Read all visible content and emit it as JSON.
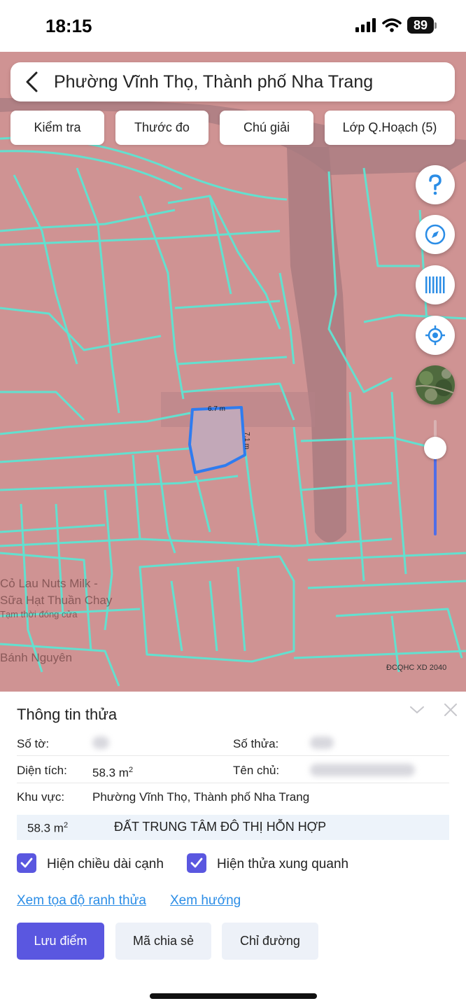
{
  "status_bar": {
    "time": "18:15",
    "battery": "89"
  },
  "search": {
    "title": "Phường Vĩnh Thọ, Thành phố Nha Trang"
  },
  "chips": [
    "Kiểm tra",
    "Thước đo",
    "Chú giải",
    "Lớp Q.Hoạch (5)"
  ],
  "map": {
    "measure_top": "6.7 m",
    "measure_right": "7.1 m",
    "labels": [
      "Cỏ Lau Nuts Milk -",
      "Sữa Hạt Thuần Chay",
      "Tạm thời đóng cửa",
      "Bánh Nguyên"
    ],
    "credit": "ĐCQHC XD 2040",
    "zoom_level": 0.82,
    "colors": {
      "zone": "#cf9393",
      "parcel_lines": "#63e0cf",
      "selected": "#2e7cf0",
      "road": "#a77b80"
    }
  },
  "side_buttons": [
    "help-icon",
    "compass-icon",
    "barcode-icon",
    "locate-icon",
    "satellite-layer"
  ],
  "panel": {
    "title": "Thông tin thửa",
    "so_to_label": "Số tờ:",
    "so_thua_label": "Số thửa:",
    "dien_tich_label": "Diện tích:",
    "dien_tich_value": "58.3 m",
    "dien_tich_unit_sup": "2",
    "ten_chu_label": "Tên chủ:",
    "khu_vuc_label": "Khu vực:",
    "khu_vuc_value": "Phường Vĩnh Thọ, Thành phố Nha Trang",
    "landuse": {
      "area": "58.3 m",
      "area_sup": "2",
      "name": "ĐẤT TRUNG TÂM ĐÔ THỊ HỖN HỢP"
    },
    "checkbox_edges": "Hiện chiều dài cạnh",
    "checkbox_neighbors": "Hiện thửa xung quanh",
    "link_coords": "Xem tọa độ ranh thửa",
    "link_direction": "Xem hướng",
    "btn_save": "Lưu điểm",
    "btn_share": "Mã chia sẻ",
    "btn_directions": "Chỉ đường"
  }
}
